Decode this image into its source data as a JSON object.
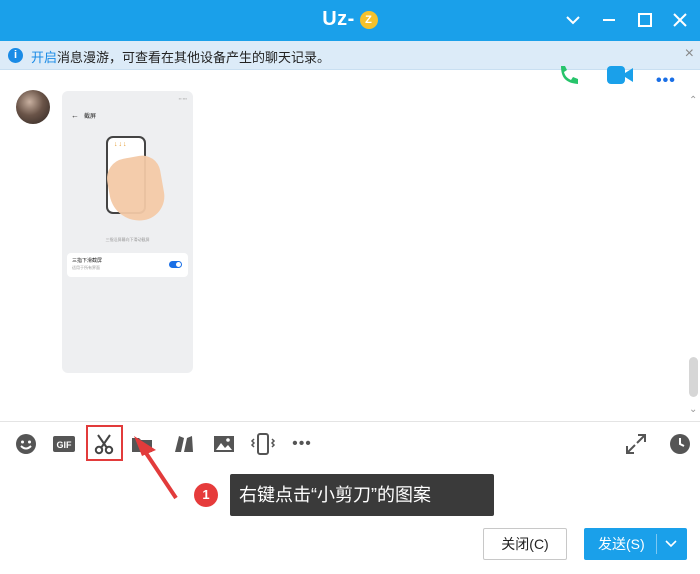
{
  "window": {
    "title": "Uz-",
    "title_badge": "Z"
  },
  "notice": {
    "link_text": "开启",
    "text": "消息漫游，可查看在其他设备产生的聊天记录。"
  },
  "message_image": {
    "back_title": "截屏",
    "caption": "三指沿屏幕向下滑动截屏",
    "card_title": "三指下滑截屏",
    "card_subtitle": "适用于所有界面"
  },
  "toolbar": {
    "icons": [
      "emoji-icon",
      "gif-icon",
      "scissors-icon",
      "folder-icon",
      "shake-icon",
      "image-icon",
      "phone-vibrate-icon",
      "more-icon",
      "expand-icon",
      "history-icon"
    ]
  },
  "callout": {
    "number": "1",
    "text": "右键点击“小剪刀”的图案"
  },
  "buttons": {
    "close": "关闭(C)",
    "send": "发送(S)"
  },
  "colors": {
    "accent": "#1aa0ea",
    "highlight": "#e23b3b",
    "call_green": "#27c46b"
  }
}
